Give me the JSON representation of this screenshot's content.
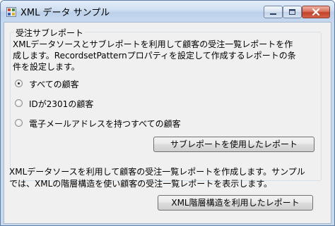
{
  "window": {
    "title": "XML データ サンプル"
  },
  "group": {
    "legend": "受注サブレポート",
    "description": "XMLデータソースとサブレポートを利用して顧客の受注一覧レポートを作\n成します。RecordsetPatternプロパティを設定して作成するレポートの条\n件を設定します。"
  },
  "options": [
    {
      "label": "すべての顧客",
      "selected": true
    },
    {
      "label": "IDが2301の顧客",
      "selected": false
    },
    {
      "label": "電子メールアドレスを持つすべての顧客",
      "selected": false
    }
  ],
  "buttons": {
    "subreport": "サブレポートを使用したレポート",
    "hierarchy": "XML階層構造を利用したレポート"
  },
  "bottom": {
    "description": "XMLデータソースを利用して顧客の受注一覧レポートを作成します。サンプル\nでは、XMLの階層構造を使い顧客の受注一覧レポートを表示します。"
  },
  "icons": {
    "app": "window-app-icon",
    "minimize": "minimize-icon",
    "maximize": "maximize-icon",
    "close": "close-icon"
  },
  "colors": {
    "titlebar": "#cfdff1",
    "close_button": "#c2412a",
    "client_bg": "#f0f0f0"
  }
}
